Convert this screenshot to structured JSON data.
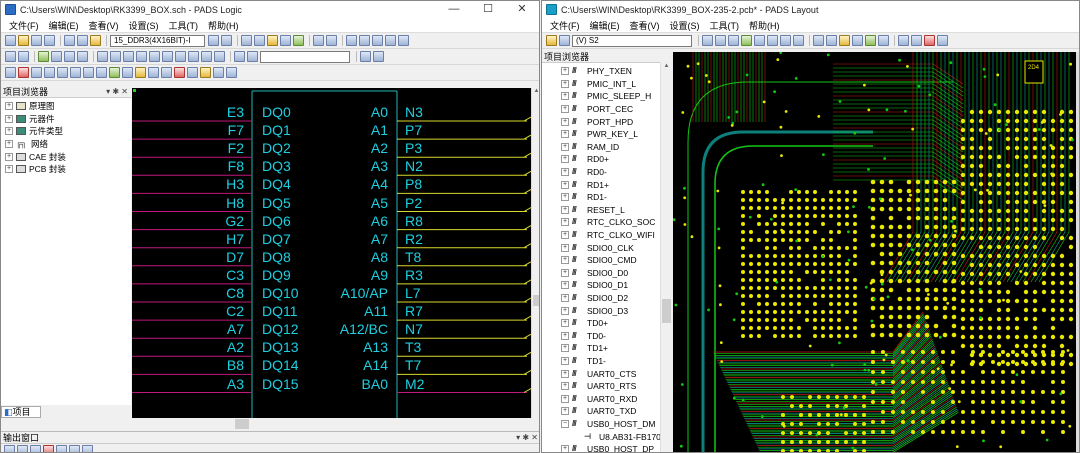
{
  "logic": {
    "title": "C:\\Users\\WIN\\Desktop\\RK3399_BOX.sch - PADS Logic",
    "window_controls": [
      "—",
      "☐",
      "✕"
    ],
    "menu": [
      "文件(F)",
      "编辑(E)",
      "查看(V)",
      "设置(S)",
      "工具(T)",
      "帮助(H)"
    ],
    "sheet_combo": "15_DDR3(4X16BIT)-I",
    "project_panel_title": "项目浏览器",
    "project_tree": [
      "原理图",
      "元器件",
      "元件类型",
      "网络",
      "CAE 封装",
      "PCB 封装"
    ],
    "project_tab": "项目",
    "output_panel_title": "输出窗口",
    "schematic": {
      "left_pins": [
        "E3",
        "F7",
        "F2",
        "F8",
        "H3",
        "H8",
        "G2",
        "H7",
        "D7",
        "C3",
        "C8",
        "C2",
        "A7",
        "A2",
        "B8",
        "A3"
      ],
      "dq_labels": [
        "DQ0",
        "DQ1",
        "DQ2",
        "DQ3",
        "DQ4",
        "DQ5",
        "DQ6",
        "DQ7",
        "DQ8",
        "DQ9",
        "DQ10",
        "DQ11",
        "DQ12",
        "DQ13",
        "DQ14",
        "DQ15"
      ],
      "addr_labels": [
        "A0",
        "A1",
        "A2",
        "A3",
        "A4",
        "A5",
        "A6",
        "A7",
        "A8",
        "A9",
        "A10/AP",
        "A11",
        "A12/BC",
        "A13",
        "A14",
        "BA0"
      ],
      "right_pins": [
        "N3",
        "P7",
        "P3",
        "N2",
        "P8",
        "P2",
        "R8",
        "R2",
        "T8",
        "R3",
        "L7",
        "R7",
        "N7",
        "T3",
        "T7",
        "M2"
      ]
    }
  },
  "layout": {
    "title": "C:\\Users\\WIN\\Desktop\\RK3399_BOX-235-2.pcb* - PADS Layout",
    "window_controls": [
      "—",
      "☐",
      "✕"
    ],
    "menu": [
      "文件(F)",
      "编辑(E)",
      "查看(V)",
      "设置(S)",
      "工具(T)",
      "帮助(H)"
    ],
    "layer_combo": "(V) S2",
    "project_panel_title": "项目浏览器",
    "nets": [
      "PHY_TXEN",
      "PMIC_INT_L",
      "PMIC_SLEEP_H",
      "PORT_CEC",
      "PORT_HPD",
      "PWR_KEY_L",
      "RAM_ID",
      "RD0+",
      "RD0-",
      "RD1+",
      "RD1-",
      "RESET_L",
      "RTC_CLKO_SOC",
      "RTC_CLKO_WIFI",
      "SDIO0_CLK",
      "SDIO0_CMD",
      "SDIO0_D0",
      "SDIO0_D1",
      "SDIO0_D2",
      "SDIO0_D3",
      "TD0+",
      "TD0-",
      "TD1+",
      "TD1-",
      "UART0_CTS",
      "UART0_RTS",
      "UART0_RXD",
      "UART0_TXD",
      "USB0_HOST_DM"
    ],
    "subitem": "U8.AB31-FB170",
    "last_net": "USB0_HOST_DP",
    "chip_label": "2D4",
    "colors": {
      "pad": "#e8e800",
      "trace_green": "#12c812",
      "trace_teal": "#0fa19a",
      "trace_red": "#c01818"
    }
  }
}
